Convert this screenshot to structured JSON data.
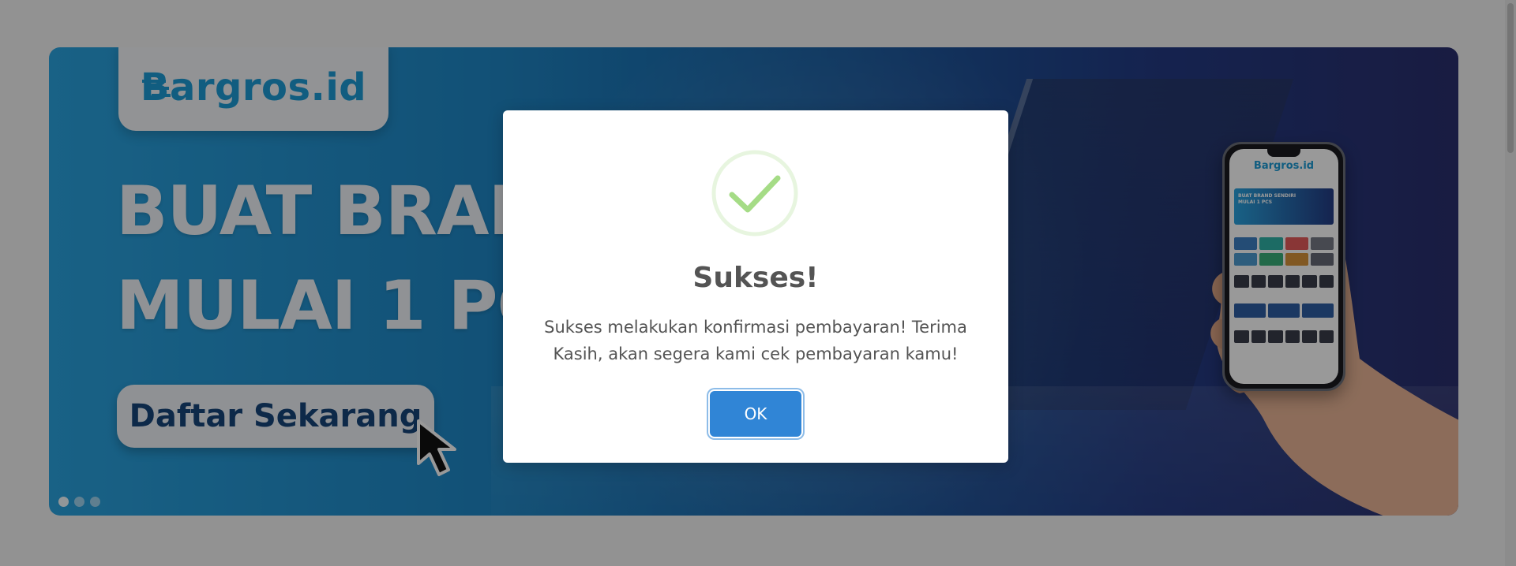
{
  "banner": {
    "logo_text": "Bargros.id",
    "headline": "BUAT BRAND\nMULAI 1 PCS",
    "cta_label": "Daftar Sekarang",
    "slide_count": 3,
    "active_slide": 1,
    "phone": {
      "logo_text": "Bargros.id",
      "banner_text": "BUAT BRAND SENDIRI\nMULAI 1 PCS"
    }
  },
  "modal": {
    "title": "Sukses!",
    "message": "Sukses melakukan konfirmasi pembayaran! Terima Kasih, akan segera kami cek pembayaran kamu!",
    "ok_label": "OK",
    "icon": "success-check-icon"
  },
  "colors": {
    "primary_button": "#3085d6",
    "success": "#a5dc86",
    "brand": "#1d9bd6",
    "overlay": "rgba(0,0,0,0.40)"
  }
}
